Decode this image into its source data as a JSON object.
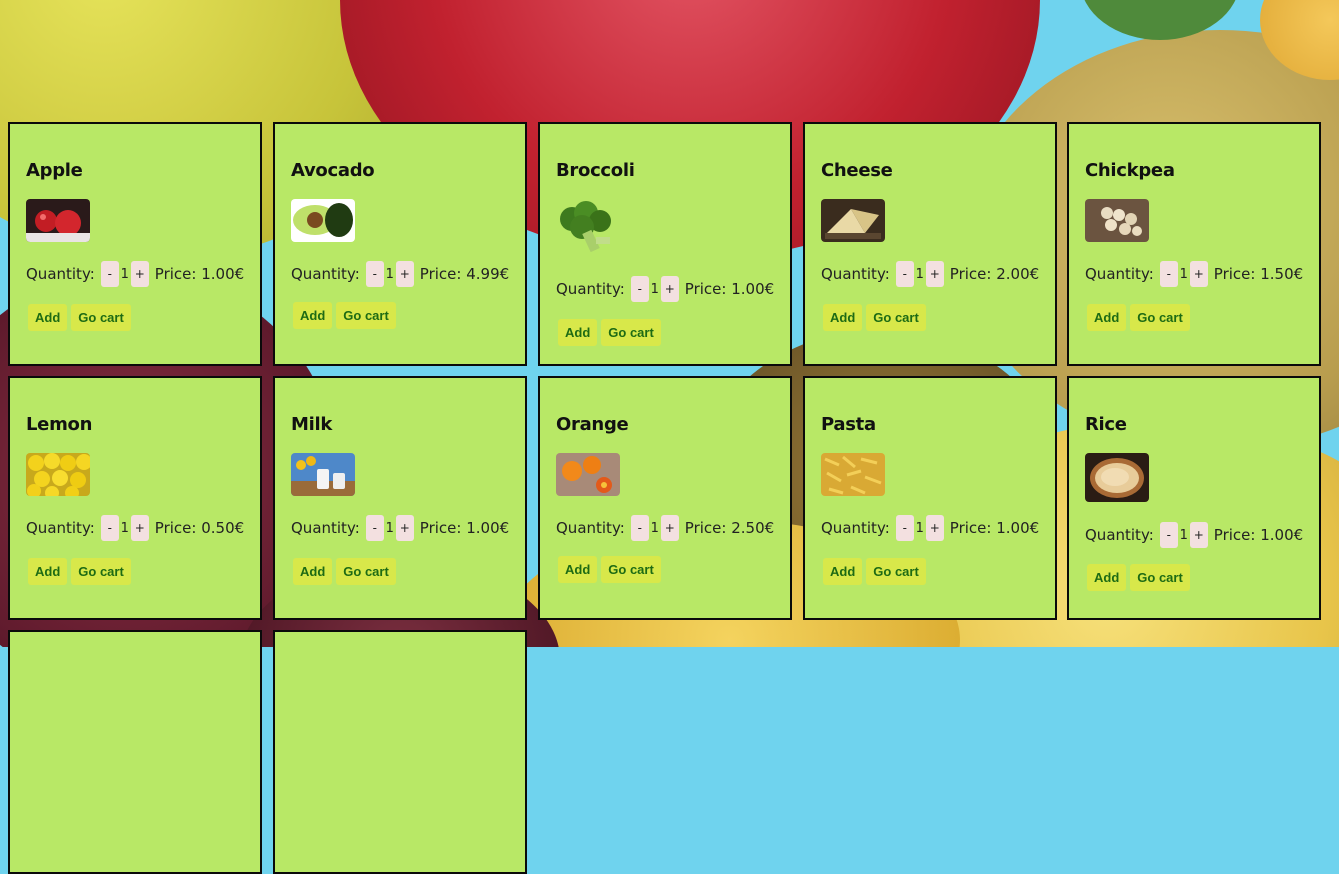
{
  "labels": {
    "quantity": "Quantity:",
    "price": "Price:",
    "minus": "-",
    "plus": "+",
    "add": "Add",
    "go_cart": "Go cart"
  },
  "products": [
    {
      "name": "Apple",
      "quantity": "1",
      "price": "1.00€",
      "image": "apples-photo"
    },
    {
      "name": "Avocado",
      "quantity": "1",
      "price": "4.99€",
      "image": "avocado-photo"
    },
    {
      "name": "Broccoli",
      "quantity": "1",
      "price": "1.00€",
      "image": "broccoli-photo"
    },
    {
      "name": "Cheese",
      "quantity": "1",
      "price": "2.00€",
      "image": "cheese-photo"
    },
    {
      "name": "Chickpea",
      "quantity": "1",
      "price": "1.50€",
      "image": "chickpea-photo"
    },
    {
      "name": "Lemon",
      "quantity": "1",
      "price": "0.50€",
      "image": "lemons-photo"
    },
    {
      "name": "Milk",
      "quantity": "1",
      "price": "1.00€",
      "image": "milk-photo"
    },
    {
      "name": "Orange",
      "quantity": "1",
      "price": "2.50€",
      "image": "oranges-photo"
    },
    {
      "name": "Pasta",
      "quantity": "1",
      "price": "1.00€",
      "image": "pasta-photo"
    },
    {
      "name": "Rice",
      "quantity": "1",
      "price": "1.00€",
      "image": "rice-photo"
    }
  ],
  "colors": {
    "card_bg": "#b8e866",
    "card_border": "#0a0a0a",
    "button_bg": "#d8e84a",
    "button_text": "#1e6b14",
    "stepper_bg": "#f3e0e0"
  }
}
